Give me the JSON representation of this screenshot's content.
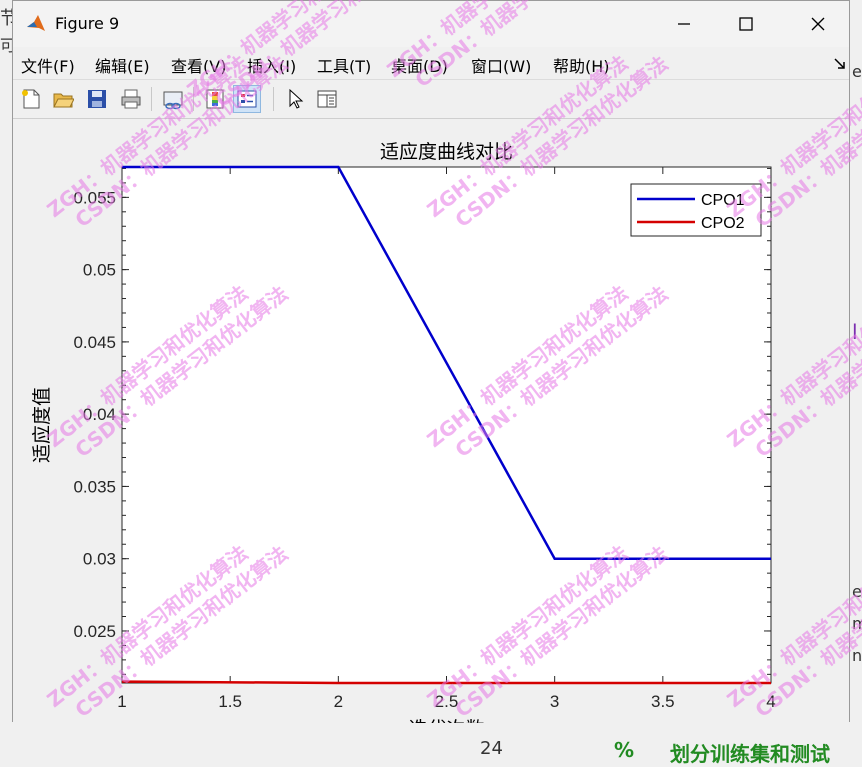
{
  "window": {
    "title": "Figure 9"
  },
  "menu": [
    "文件(F)",
    "编辑(E)",
    "查看(V)",
    "插入(I)",
    "工具(T)",
    "桌面(D)",
    "窗口(W)",
    "帮助(H)"
  ],
  "toolbar": {
    "icons": [
      "new-file-icon",
      "open-folder-icon",
      "save-icon",
      "print-icon",
      "link-plot-icon",
      "colorbar-icon",
      "legend-icon",
      "pointer-icon",
      "property-inspector-icon"
    ]
  },
  "watermark": "ZGH：机器学习和优化算法\nCSDN：机器学习和优化算法",
  "background": {
    "left_top": "节",
    "left_second": "可",
    "right_top": "e",
    "right_l": "l",
    "right_e": "e",
    "right_m": "m",
    "right_n": "n",
    "bottom_num": "24",
    "bottom_pct": "%",
    "bottom_text": "划分训练集和测试"
  },
  "chart_data": {
    "type": "line",
    "title": "适应度曲线对比",
    "xlabel": "迭代次数",
    "ylabel": "适应度值",
    "xlim": [
      1,
      4
    ],
    "ylim": [
      0.0214,
      0.0571
    ],
    "x": [
      1,
      2,
      3,
      4
    ],
    "xticks": [
      "1",
      "1.5",
      "2",
      "2.5",
      "3",
      "3.5",
      "4"
    ],
    "yticks": [
      "0.025",
      "0.03",
      "0.035",
      "0.04",
      "0.045",
      "0.05",
      "0.055"
    ],
    "series": [
      {
        "name": "CPO1",
        "color": "#0000cc",
        "values": [
          0.0571,
          0.0571,
          0.03,
          0.03
        ]
      },
      {
        "name": "CPO2",
        "color": "#d40000",
        "values": [
          0.0215,
          0.0214,
          0.0214,
          0.0214
        ]
      }
    ],
    "legend": "top-right",
    "grid": false
  }
}
